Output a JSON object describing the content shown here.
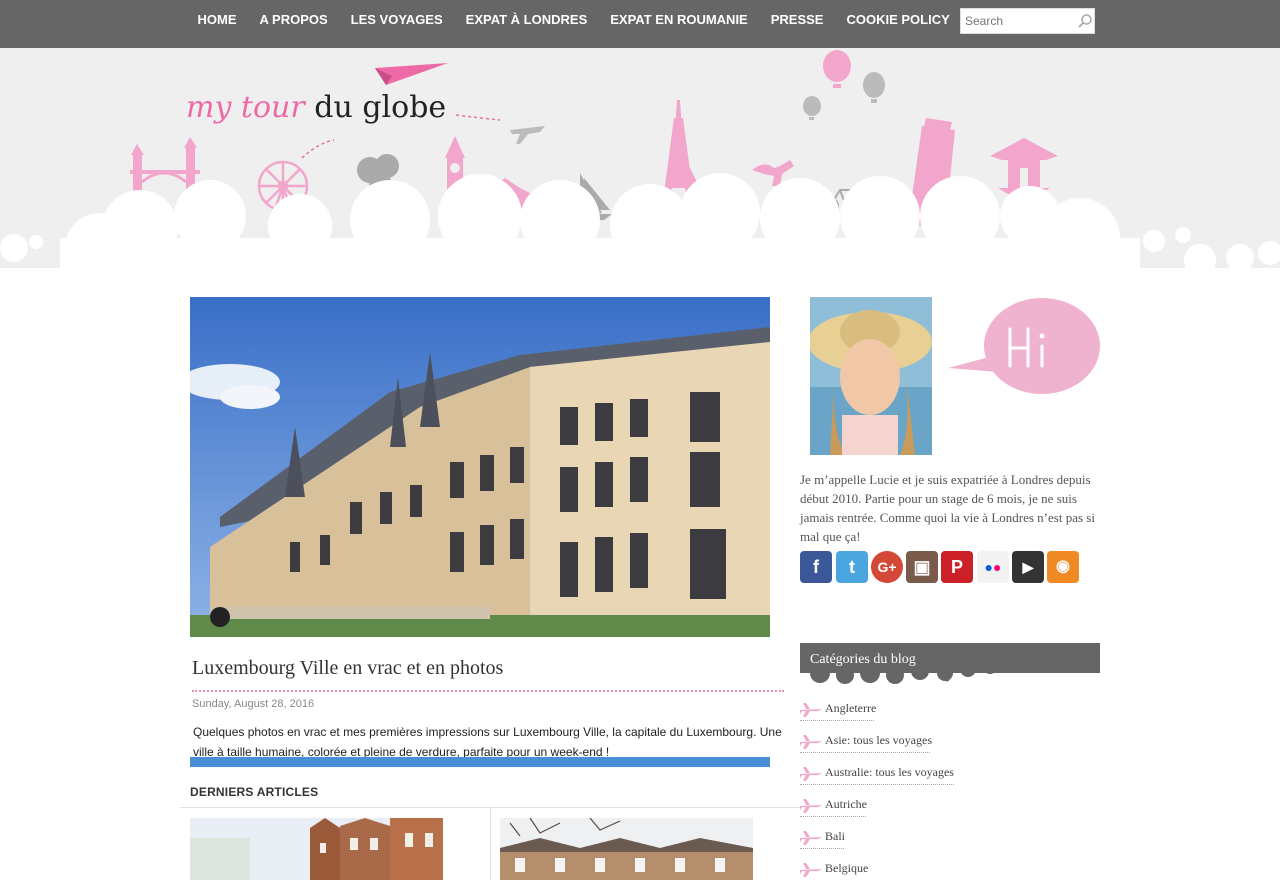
{
  "nav": {
    "items": [
      "HOME",
      "A PROPOS",
      "LES VOYAGES",
      "EXPAT À LONDRES",
      "EXPAT EN ROUMANIE",
      "PRESSE",
      "COOKIE POLICY"
    ],
    "search_placeholder": "Search"
  },
  "header": {
    "logo_part1": "my tour",
    "logo_part2": "du globe"
  },
  "post": {
    "title": "Luxembourg Ville en vrac et en photos",
    "date": "Sunday, August 28, 2016",
    "excerpt": "Quelques photos en vrac et mes premières impressions sur Luxembourg Ville, la capitale du Luxembourg. Une ville à taille humaine, colorée et pleine de verdure, parfaite pour un week-end !"
  },
  "latest": {
    "title": "DERNIERS ARTICLES"
  },
  "sidebar": {
    "bio": "Je m’appelle Lucie et je suis expatriée à Londres depuis début 2010. Partie pour un stage de 6 mois, je ne suis jamais rentrée. Comme quoi la vie à Londres n’est pas si mal que ça!",
    "social_icons": [
      "facebook-icon",
      "twitter-icon",
      "google-plus-icon",
      "instagram-icon",
      "pinterest-icon",
      "flickr-icon",
      "youtube-icon",
      "rss-icon"
    ],
    "categories_title": "Catégories du blog",
    "categories": [
      "Angleterre",
      "Asie: tous les voyages",
      "Australie: tous les voyages",
      "Autriche",
      "Bali",
      "Belgique"
    ]
  },
  "colors": {
    "nav_bg": "#666666",
    "pink": "#ee6aa7",
    "header_bg": "#efefef",
    "category_header": "#666666"
  }
}
